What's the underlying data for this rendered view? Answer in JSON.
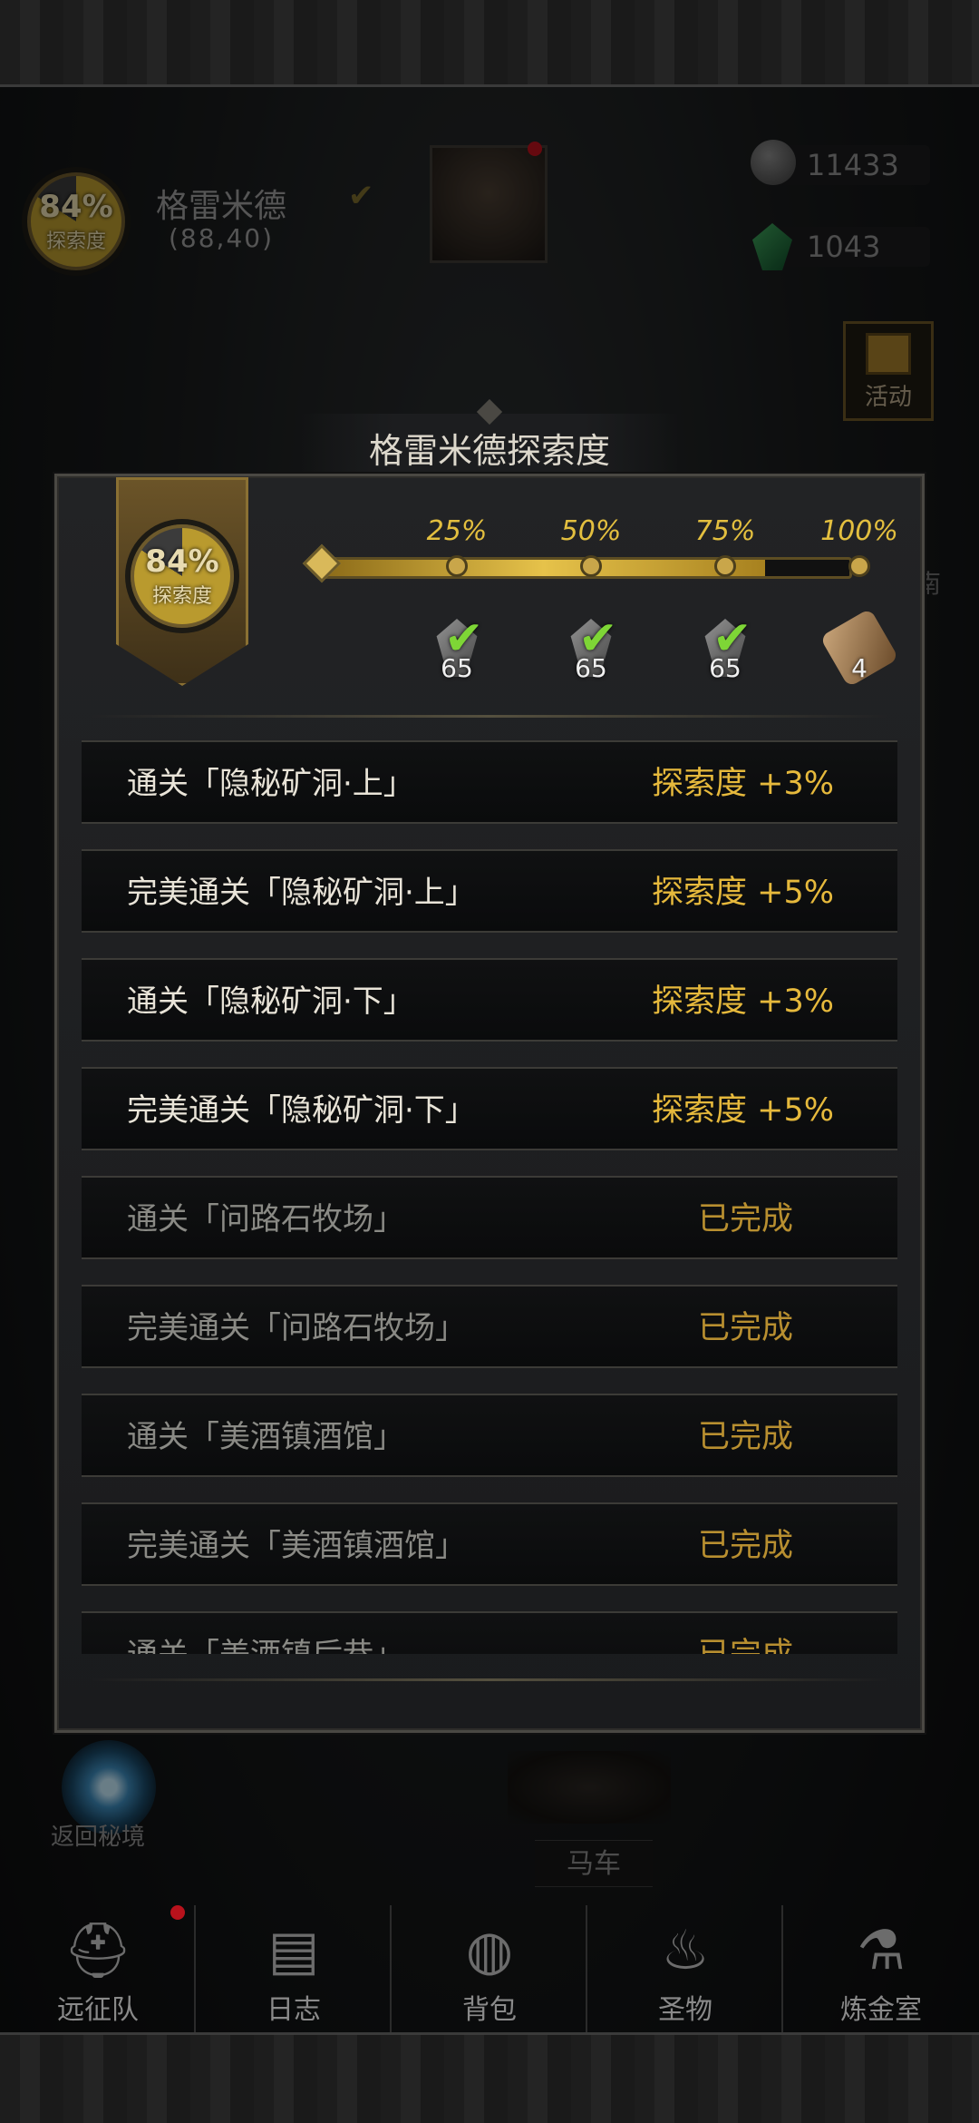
{
  "hud": {
    "zone_name": "格雷米德",
    "coords": "(88,40)",
    "exploration_pct": "84%",
    "exploration_label": "探索度",
    "currency_1": "11433",
    "currency_2": "1043",
    "event_label": "活动",
    "side_peek_char": "南"
  },
  "panel": {
    "title": "格雷米德探索度",
    "badge_pct": "84%",
    "badge_label": "探索度",
    "progress_fraction": 0.84,
    "milestones": [
      {
        "pct": "25%",
        "reward_count": "65",
        "claimed": true
      },
      {
        "pct": "50%",
        "reward_count": "65",
        "claimed": true
      },
      {
        "pct": "75%",
        "reward_count": "65",
        "claimed": true
      },
      {
        "pct": "100%",
        "reward_count": "4",
        "claimed": false
      }
    ],
    "tasks": [
      {
        "name": "通关「隐秘矿洞·上」",
        "status": "探索度 +3%",
        "done": false
      },
      {
        "name": "完美通关「隐秘矿洞·上」",
        "status": "探索度 +5%",
        "done": false
      },
      {
        "name": "通关「隐秘矿洞·下」",
        "status": "探索度 +3%",
        "done": false
      },
      {
        "name": "完美通关「隐秘矿洞·下」",
        "status": "探索度 +5%",
        "done": false
      },
      {
        "name": "通关「问路石牧场」",
        "status": "已完成",
        "done": true
      },
      {
        "name": "完美通关「问路石牧场」",
        "status": "已完成",
        "done": true
      },
      {
        "name": "通关「美酒镇酒馆」",
        "status": "已完成",
        "done": true
      },
      {
        "name": "完美通关「美酒镇酒馆」",
        "status": "已完成",
        "done": true
      },
      {
        "name": "通关「美酒镇后巷」",
        "status": "已完成",
        "done": true
      }
    ]
  },
  "map": {
    "return_label": "返回秘境",
    "carriage_label": "马车"
  },
  "nav": [
    {
      "label": "远征队",
      "icon": "helmet-icon"
    },
    {
      "label": "日志",
      "icon": "scroll-icon"
    },
    {
      "label": "背包",
      "icon": "bag-icon"
    },
    {
      "label": "圣物",
      "icon": "torch-icon"
    },
    {
      "label": "炼金室",
      "icon": "alchemy-icon"
    }
  ],
  "colors": {
    "gold": "#e6b93c",
    "done_gray": "#8a8a85",
    "check_green": "#7ed636"
  }
}
